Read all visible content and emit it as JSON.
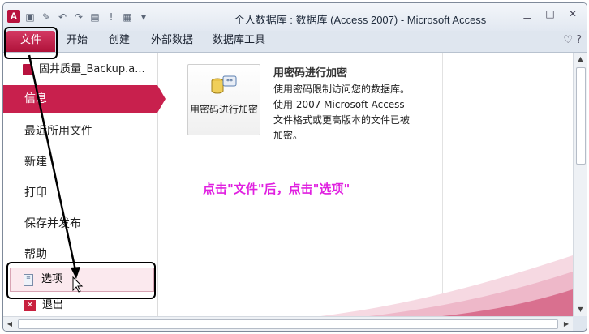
{
  "window": {
    "title": "个人数据库 : 数据库 (Access 2007) - Microsoft Access",
    "app_icon": "A",
    "qat_icons": [
      "save-icon",
      "edit-icon",
      "undo-icon",
      "redo-icon",
      "print-icon",
      "run-icon",
      "table-icon",
      "customize-icon"
    ]
  },
  "tabs": [
    "文件",
    "开始",
    "创建",
    "外部数据",
    "数据库工具"
  ],
  "nav": {
    "recent_file": "固井质量_Backup.a...",
    "items": [
      "信息",
      "最近所用文件",
      "新建",
      "打印",
      "保存并发布",
      "帮助"
    ],
    "options": "选项",
    "exit": "退出"
  },
  "content": {
    "button_label": "用密码进行加密",
    "section_title": "用密码进行加密",
    "section_desc": "使用密码限制访问您的数据库。使用 2007 Microsoft Access 文件格式或更高版本的文件已被加密。"
  },
  "annotation": "点击\"文件\"后，点击\"选项\"",
  "colors": {
    "accent": "#c8204d",
    "annotation": "#e020e0"
  }
}
